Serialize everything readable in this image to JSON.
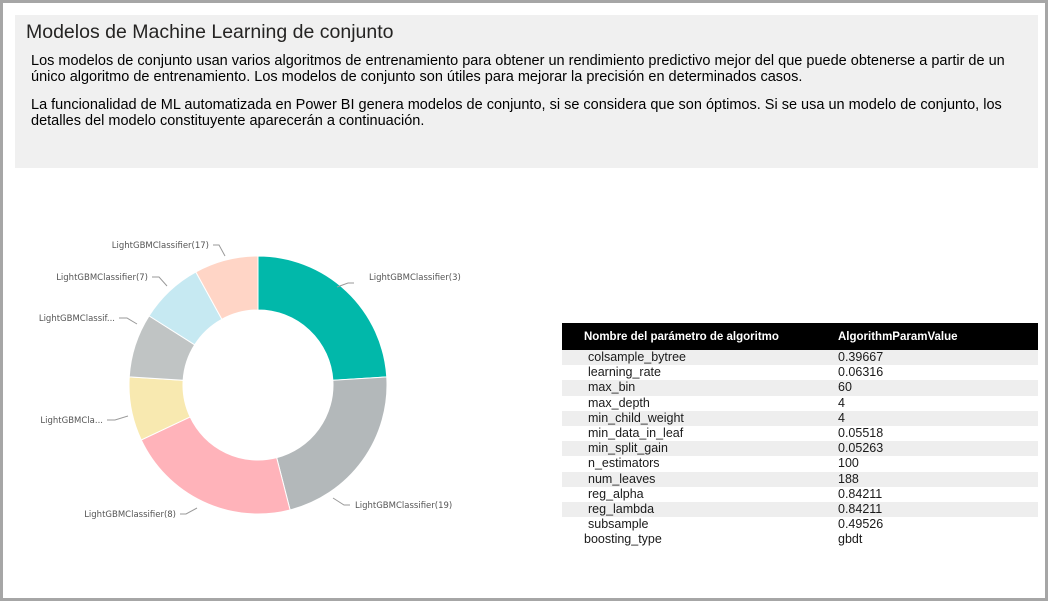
{
  "info": {
    "title": "Modelos de Machine Learning de conjunto",
    "paragraphs": [
      "Los modelos de conjunto usan varios algoritmos de entrenamiento para obtener un rendimiento predictivo mejor del que puede obtenerse a partir de un único algoritmo de entrenamiento. Los modelos de conjunto son útiles para mejorar la precisión en determinados casos.",
      "La funcionalidad de ML automatizada en Power BI genera modelos de conjunto, si se considera que son óptimos. Si se usa un modelo de conjunto, los detalles del modelo constituyente aparecerán a continuación."
    ]
  },
  "chart_data": {
    "type": "pie",
    "donut": true,
    "slices": [
      {
        "label": "LightGBMClassifier(3)",
        "value": 24,
        "color": "#01b8aa"
      },
      {
        "label": "LightGBMClassifier(19)",
        "value": 22,
        "color": "#b3b8ba"
      },
      {
        "label": "LightGBMClassifier(8)",
        "value": 22,
        "color": "#ffb3ba"
      },
      {
        "label": "LightGBMCla...",
        "value": 8,
        "color": "#f8e9b0"
      },
      {
        "label": "LightGBMClassif...",
        "value": 8,
        "color": "#c0c4c4"
      },
      {
        "label": "LightGBMClassifier(7)",
        "value": 8,
        "color": "#c6e9f2"
      },
      {
        "label": "LightGBMClassifier(17)",
        "value": 8,
        "color": "#ffd5c6"
      }
    ]
  },
  "table": {
    "headers": [
      "Nombre del parámetro de algoritmo",
      "AlgorithmParamValue"
    ],
    "rows": [
      [
        "colsample_bytree",
        "0.39667"
      ],
      [
        "learning_rate",
        "0.06316"
      ],
      [
        "max_bin",
        "60"
      ],
      [
        "max_depth",
        "4"
      ],
      [
        "min_child_weight",
        "4"
      ],
      [
        "min_data_in_leaf",
        "0.05518"
      ],
      [
        "min_split_gain",
        "0.05263"
      ],
      [
        "n_estimators",
        "100"
      ],
      [
        "num_leaves",
        "188"
      ],
      [
        "reg_alpha",
        "0.84211"
      ],
      [
        "reg_lambda",
        "0.84211"
      ],
      [
        "subsample",
        "0.49526"
      ],
      [
        "boosting_type",
        "gbdt"
      ]
    ]
  }
}
